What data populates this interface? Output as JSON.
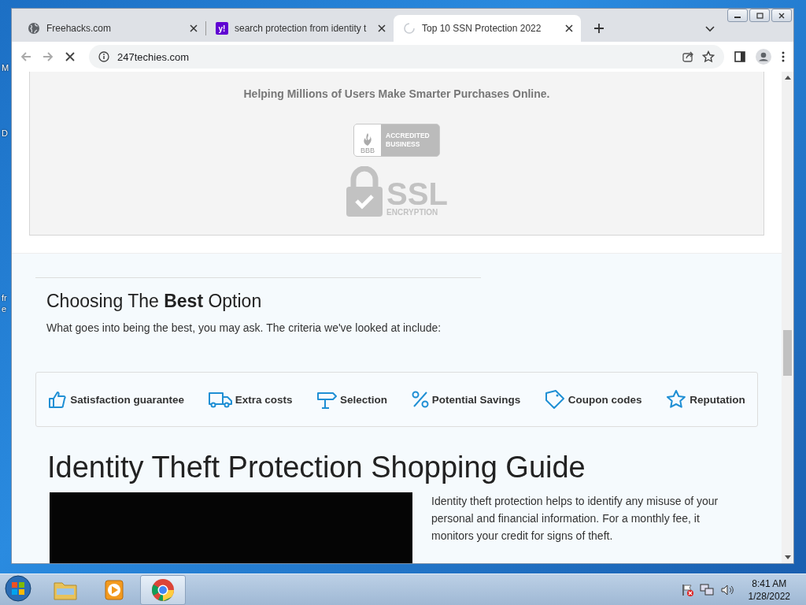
{
  "desktop": {
    "edge_labels": [
      "M",
      "D",
      "fr",
      "e"
    ]
  },
  "browser": {
    "tabs": [
      {
        "title": "Freehacks.com",
        "selected": false,
        "kind": "globe"
      },
      {
        "title": "search protection from identity t",
        "selected": false,
        "kind": "letter",
        "favicon_text": "y!"
      },
      {
        "title": "Top 10 SSN Protection 2022",
        "selected": true,
        "kind": "loading"
      }
    ],
    "url": "247techies.com"
  },
  "page": {
    "trust_box": {
      "tagline": "Helping Millions of Users Make Smarter Purchases Online.",
      "bbb": {
        "mark": "BBB",
        "lines": [
          "ACCREDITED",
          "BUSINESS"
        ]
      },
      "ssl": {
        "title": "SSL",
        "subtitle": "ENCRYPTION"
      }
    },
    "criteria_section": {
      "heading": "Choosing The **Best** Option",
      "intro": "What goes into being the best, you may ask. The criteria we've looked at include:",
      "criteria": [
        {
          "label": "Satisfaction guarantee",
          "kind": "thumb"
        },
        {
          "label": "Extra costs",
          "kind": "truck"
        },
        {
          "label": "Selection",
          "kind": "signpost"
        },
        {
          "label": "Potential Savings",
          "kind": "percent"
        },
        {
          "label": "Coupon codes",
          "kind": "tag"
        },
        {
          "label": "Reputation",
          "kind": "star"
        }
      ]
    },
    "guide": {
      "title": "Identity Theft Protection Shopping Guide",
      "paragraph": "Identity theft protection helps to identify any misuse of your personal and financial information. For a monthly fee, it monitors your credit for signs of theft."
    }
  },
  "taskbar": {
    "apps": [
      {
        "kind": "folder",
        "selected": false
      },
      {
        "kind": "media",
        "selected": false
      },
      {
        "kind": "chrome",
        "selected": true
      }
    ],
    "clock": {
      "time": "8:41 AM",
      "date": "1/28/2022"
    }
  }
}
